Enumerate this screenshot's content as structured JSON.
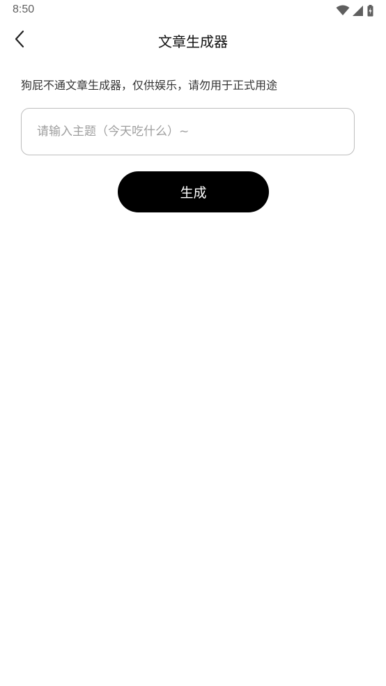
{
  "status_bar": {
    "time": "8:50",
    "icons": [
      "wifi-icon",
      "signal-icon",
      "battery-charging-icon"
    ]
  },
  "app_bar": {
    "back_icon": "chevron-left-icon",
    "title": "文章生成器"
  },
  "main": {
    "description": "狗屁不通文章生成器，仅供娱乐，请勿用于正式用途",
    "topic_input": {
      "value": "",
      "placeholder": "请输入主题（今天吃什么）~"
    },
    "generate_label": "生成"
  },
  "colors": {
    "accent": "#000000",
    "background": "#ffffff",
    "border": "#bdbdbd",
    "placeholder": "#9e9e9e"
  }
}
